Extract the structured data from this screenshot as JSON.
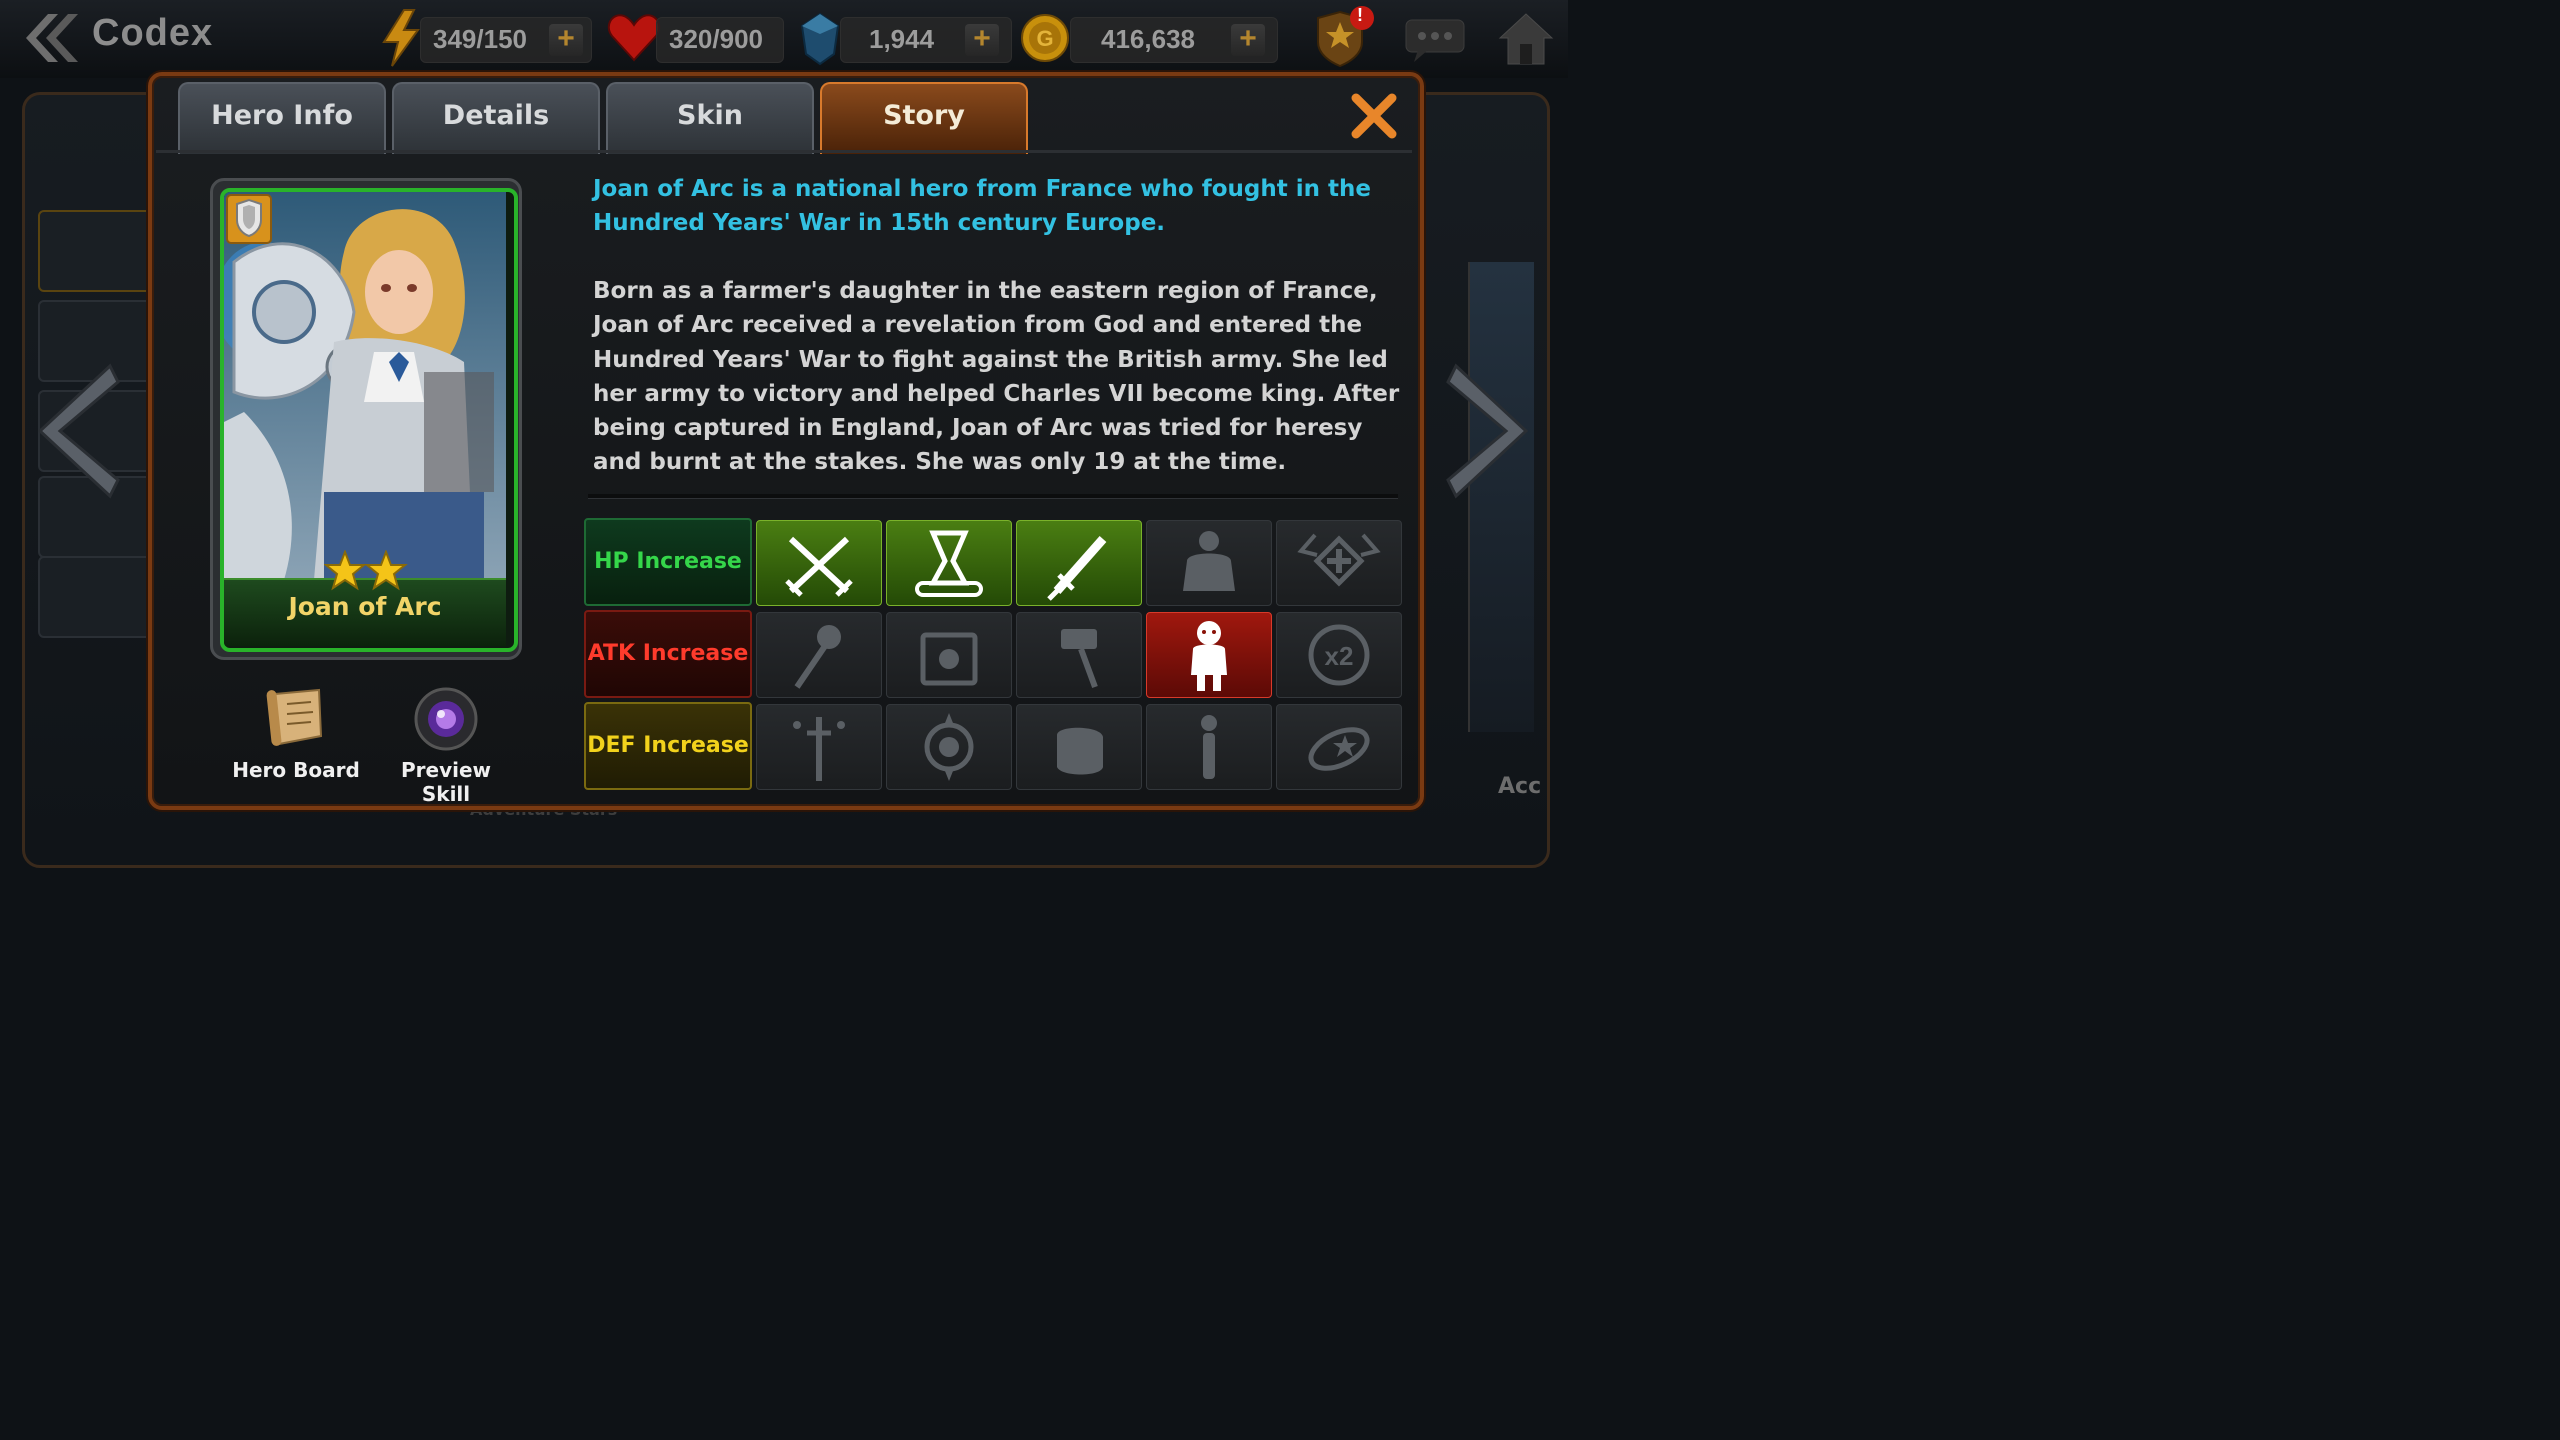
{
  "topbar": {
    "title": "Codex",
    "resources": [
      {
        "name": "stamina",
        "value": "349/150"
      },
      {
        "name": "hearts",
        "value": "320/900"
      },
      {
        "name": "crystals",
        "value": "1,944"
      },
      {
        "name": "gold",
        "value": "416,638"
      }
    ],
    "notification_badge": "!"
  },
  "tabs": [
    {
      "label": "Hero Info",
      "active": false
    },
    {
      "label": "Details",
      "active": false
    },
    {
      "label": "Skin",
      "active": false
    },
    {
      "label": "Story",
      "active": true
    }
  ],
  "hero": {
    "name": "Joan of Arc",
    "stars": 2
  },
  "actions": {
    "hero_board": "Hero Board",
    "preview_skill": "Preview Skill"
  },
  "story": {
    "intro": "Joan of Arc is a national hero from France who fought in the Hundred Years' War in 15th century Europe.",
    "body": "Born as a farmer's daughter in the eastern region of France, Joan of Arc received a revelation from God and entered the Hundred Years' War to fight against the British army. She led her army to victory and helped Charles VII become king. After being captured in England, Joan of Arc was tried for heresy and burnt at the stakes. She was only 19 at the time."
  },
  "stats": {
    "rows": [
      {
        "label": "HP Increase",
        "color": "#35d64a"
      },
      {
        "label": "ATK Increase",
        "color": "#ff3b2c"
      },
      {
        "label": "DEF Increase",
        "color": "#f2d21c"
      }
    ],
    "grid_icons": [
      [
        "crossed-swords-icon",
        "hourglass-scroll-icon",
        "sword-icon",
        "body-silhouette-icon",
        "winged-cross-icon"
      ],
      [
        "mace-icon",
        "spellbook-icon",
        "hammer-icon",
        "person-icon",
        "x2-icon"
      ],
      [
        "dagger-stars-icon",
        "sun-emblem-icon",
        "fist-icon",
        "slim-figure-icon",
        "orbit-star-icon"
      ]
    ],
    "highlight": {
      "green": [
        [
          0,
          0
        ],
        [
          0,
          1
        ],
        [
          0,
          2
        ]
      ],
      "red": [
        [
          1,
          3
        ]
      ]
    },
    "x2_label": "x2"
  },
  "background": {
    "bottom_text": "Adventure Stars",
    "right_text": "Acc"
  },
  "colors": {
    "accent_orange": "#d87a2c",
    "hero_frame_green": "#29b32a",
    "story_intro_cyan": "#33c1e2",
    "gold_text": "#f2d468"
  }
}
